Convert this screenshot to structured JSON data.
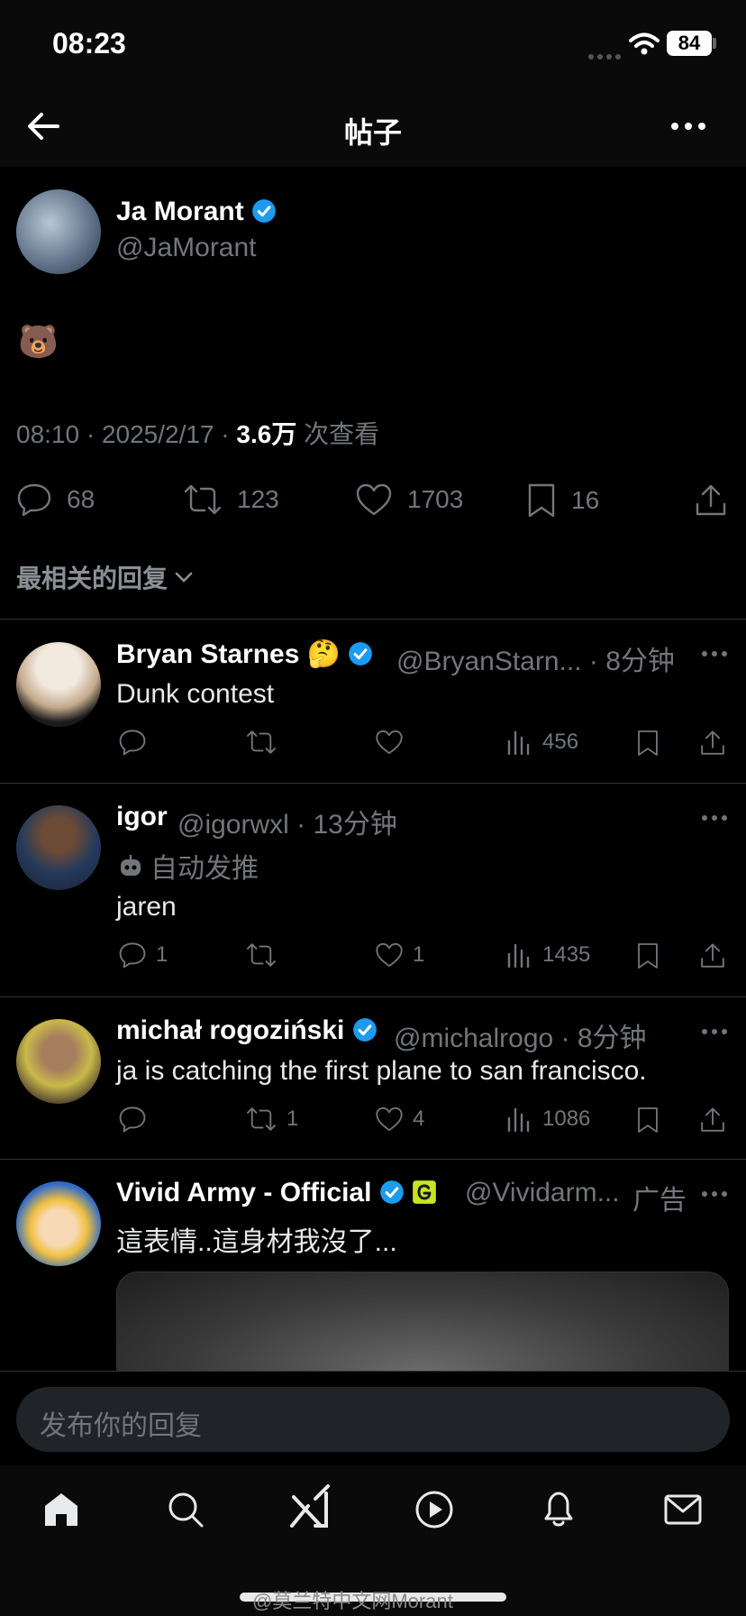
{
  "status_bar": {
    "time": "08:23",
    "battery": "84"
  },
  "header": {
    "title": "帖子"
  },
  "post": {
    "author_name": "Ja Morant",
    "author_handle": "@JaMorant",
    "content": "🐻",
    "meta_time": "08:10 · 2025/2/17 · ",
    "meta_views": "3.6万",
    "meta_views_label": " 次查看",
    "stats": {
      "replies": "68",
      "reposts": "123",
      "likes": "1703",
      "bookmarks": "16"
    }
  },
  "sort": {
    "label": "最相关的回复"
  },
  "replies": [
    {
      "name": "Bryan Starnes",
      "emoji": "🤔",
      "handle": "@BryanStarn... · 8分钟",
      "text": "Dunk contest",
      "views": "456"
    },
    {
      "name": "igor",
      "handle": "@igorwxl · 13分钟",
      "auto_label": "自动发推",
      "text": "jaren",
      "replies": "1",
      "likes": "1",
      "views": "1435"
    },
    {
      "name": "michał rogoziński",
      "handle": "@michalrogo · 8分钟",
      "text": "ja is catching the first plane to san francisco.",
      "reposts": "1",
      "likes": "4",
      "views": "1086"
    },
    {
      "name": "Vivid Army - Official",
      "handle": "@Vividarm...",
      "ad_label": "广告",
      "text": "這表情..這身材我沒了..."
    }
  ],
  "composer": {
    "placeholder": "发布你的回复"
  },
  "watermark": "@莫兰特中文网Morant",
  "colors": {
    "accent": "#1d9bf0",
    "background": "#000000",
    "muted": "#71767b"
  }
}
